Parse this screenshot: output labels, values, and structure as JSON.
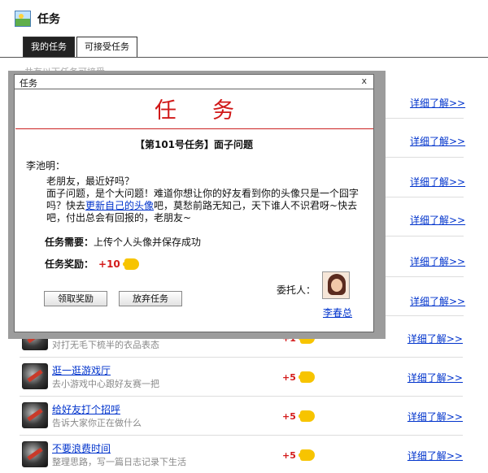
{
  "header": {
    "title": "任务"
  },
  "tabs": [
    {
      "label": "我的任务"
    },
    {
      "label": "可接受任务"
    }
  ],
  "hint_text": "共有以下任务可接受",
  "side_links": [
    {
      "label": "详细了解>>"
    },
    {
      "label": "详细了解>>"
    },
    {
      "label": "详细了解>>"
    },
    {
      "label": "详细了解>>"
    },
    {
      "label": "详细了解>>"
    },
    {
      "label": "详细了解>>"
    }
  ],
  "tasks": [
    {
      "title": "",
      "desc": "对打无毛下梳半的衣品表态",
      "reward": "+1",
      "link": "详细了解>>"
    },
    {
      "title": "逛一逛游戏厅",
      "desc": "去小游戏中心跟好友赛一把",
      "reward": "+5",
      "link": "详细了解>>"
    },
    {
      "title": "给好友打个招呼",
      "desc": "告诉大家你正在做什么",
      "reward": "+5",
      "link": "详细了解>>"
    },
    {
      "title": "不要浪费时间",
      "desc": "整理思路，写一篇日志记录下生活",
      "reward": "+5",
      "link": "详细了解>>"
    }
  ],
  "modal": {
    "caption": "任务",
    "close": "x",
    "banner": "任务",
    "task_name": "【第101号任务】面子问题",
    "greeting_name": "李池明：",
    "msg_line1": "老朋友，最近好吗？",
    "msg_pre": "面子问题，是个大问题！难道你想让你的好友看到你的头像只是一个囧字吗？快去",
    "msg_link": "更新自己的头像",
    "msg_post": "吧，莫愁前路无知己，天下谁人不识君呀~快去吧，付出总会有回报的，老朋友~",
    "req_label": "任务需要：",
    "req_value": "上传个人头像并保存成功",
    "reward_label": "任务奖励：",
    "reward_value": "+10",
    "claim_button": "领取奖励",
    "abandon_button": "放弃任务",
    "delegator_label": "委托人：",
    "delegator_name": "李春总"
  },
  "colors": {
    "accent_red": "#d01818",
    "link_blue": "#0033cc",
    "coin_yellow": "#f7c400"
  }
}
